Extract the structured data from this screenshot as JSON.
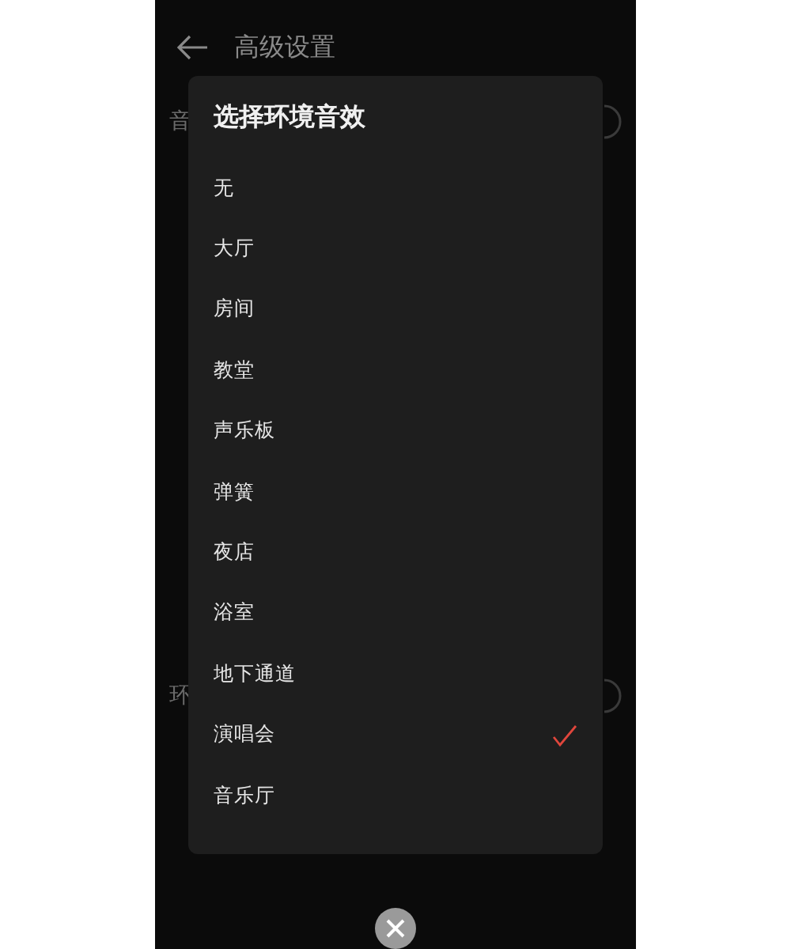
{
  "header": {
    "title": "高级设置"
  },
  "background_rows": [
    {
      "label": "音"
    },
    {
      "label": "环"
    }
  ],
  "dialog": {
    "title": "选择环境音效",
    "options": [
      {
        "label": "无",
        "selected": false
      },
      {
        "label": "大厅",
        "selected": false
      },
      {
        "label": "房间",
        "selected": false
      },
      {
        "label": "教堂",
        "selected": false
      },
      {
        "label": "声乐板",
        "selected": false
      },
      {
        "label": "弹簧",
        "selected": false
      },
      {
        "label": "夜店",
        "selected": false
      },
      {
        "label": "浴室",
        "selected": false
      },
      {
        "label": "地下通道",
        "selected": false
      },
      {
        "label": "演唱会",
        "selected": true
      },
      {
        "label": "音乐厅",
        "selected": false
      }
    ]
  }
}
